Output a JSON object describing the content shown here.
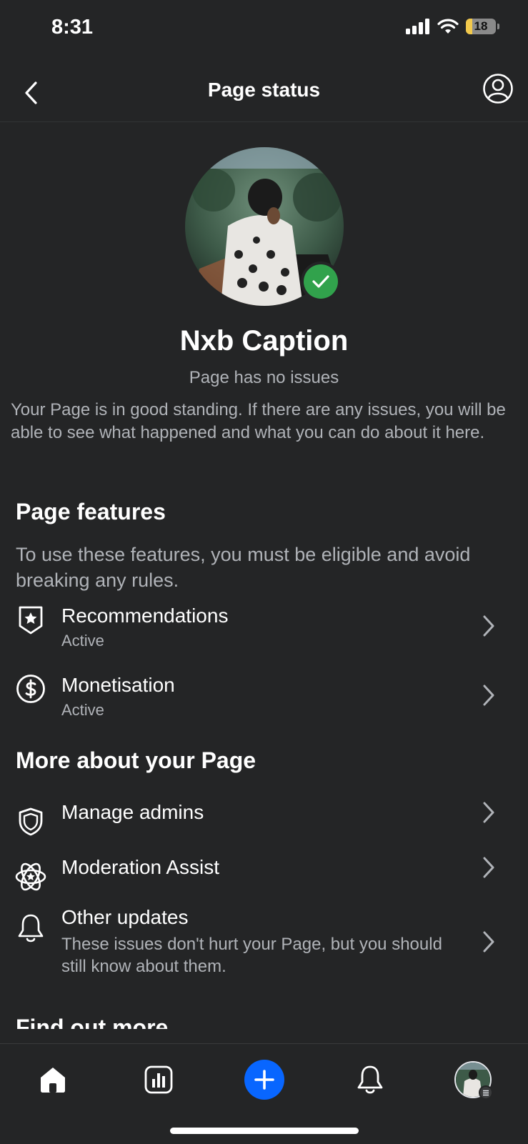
{
  "status_bar": {
    "time": "8:31",
    "battery": "18"
  },
  "header": {
    "title": "Page status"
  },
  "profile": {
    "name": "Nxb Caption",
    "status": "Page has no issues",
    "description": "Your Page is in good standing. If there are any issues, you will be able to see what happened and what you can do about it here."
  },
  "features": {
    "title": "Page features",
    "subtitle": "To use these features, you must be eligible and avoid breaking any rules.",
    "items": [
      {
        "label": "Recommendations",
        "status": "Active",
        "icon": "badge-star-icon"
      },
      {
        "label": "Monetisation",
        "status": "Active",
        "icon": "dollar-circle-icon"
      }
    ]
  },
  "more": {
    "title": "More about your Page",
    "items": [
      {
        "label": "Manage admins",
        "icon": "shield-icon"
      },
      {
        "label": "Moderation Assist",
        "icon": "atom-star-icon"
      },
      {
        "label": "Other updates",
        "description": "These issues don't hurt your Page, but you should still know about them.",
        "icon": "bell-icon"
      }
    ]
  },
  "find_more": {
    "title": "Find out more"
  },
  "tabbar": {
    "items": [
      "home-icon",
      "insights-icon",
      "create-icon",
      "notifications-icon",
      "profile-avatar"
    ]
  },
  "colors": {
    "background": "#242526",
    "accent": "#0866ff",
    "success": "#31a24c"
  }
}
